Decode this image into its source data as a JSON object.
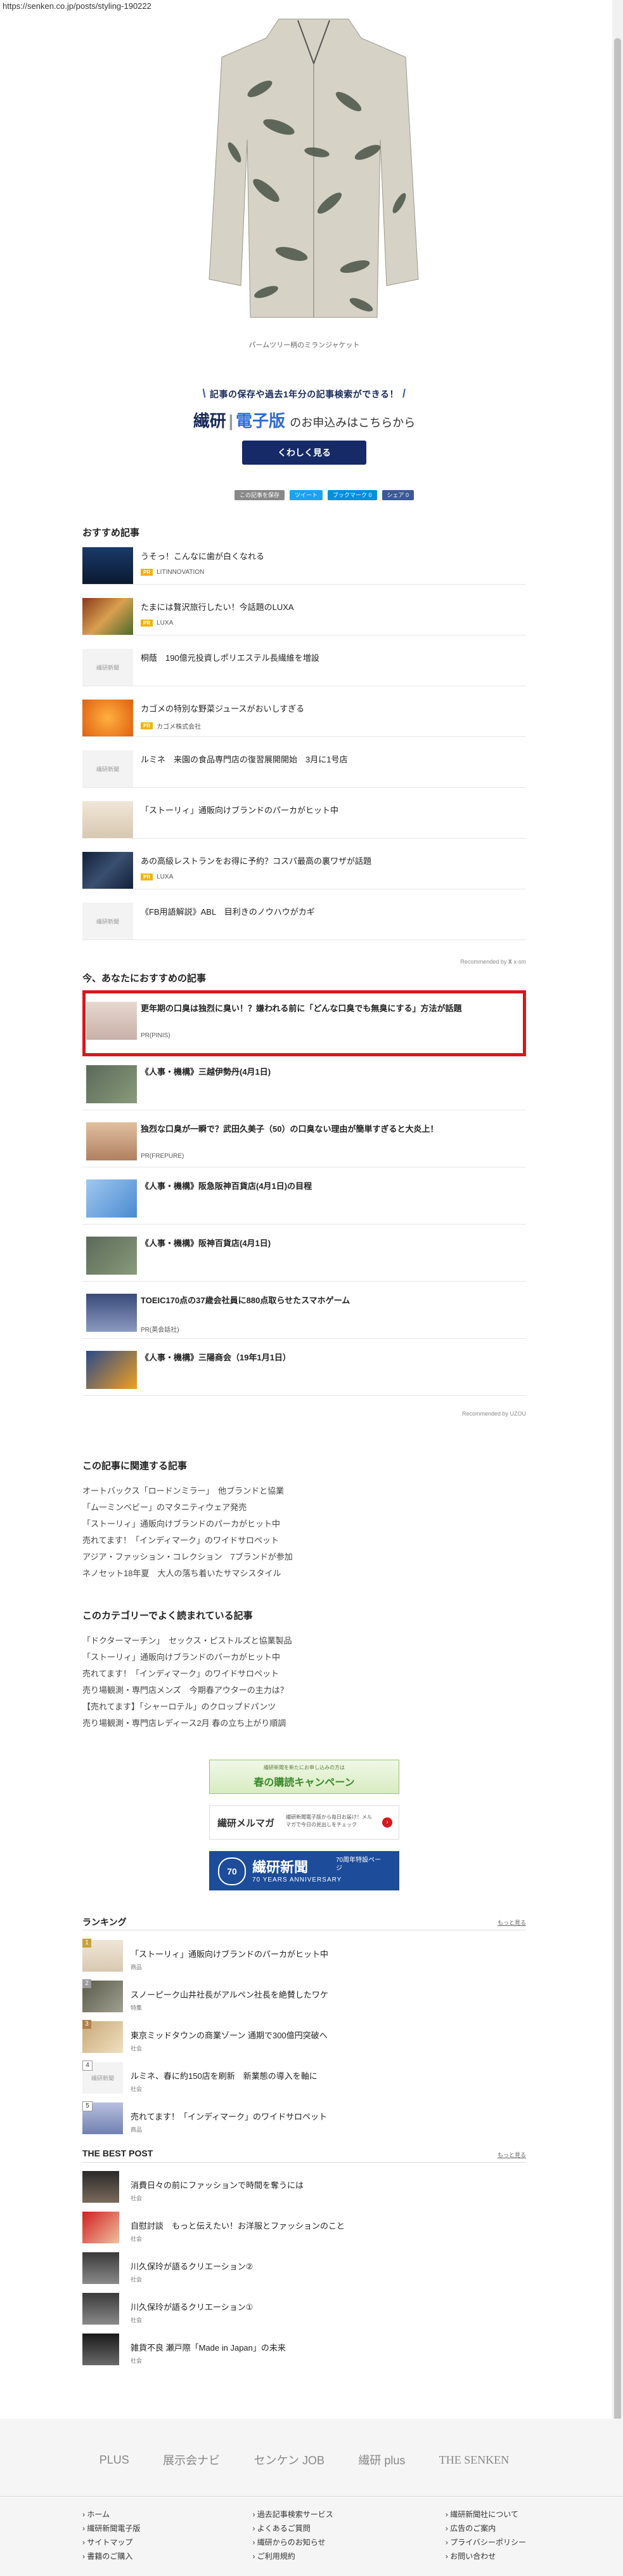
{
  "url": "https://senken.co.jp/posts/styling-190222",
  "hero": {
    "caption": "パームツリー柄のミランジャケット"
  },
  "promo": {
    "top_line": "記事の保存や過去1年分の記事検索ができる！",
    "brand": "繊研",
    "brand_blue": "電子版",
    "suffix": "のお申込みはこちらから",
    "button": "くわしく見る"
  },
  "share": [
    {
      "label": "この記事を保存",
      "color": "#888888"
    },
    {
      "label": "ツイート",
      "color": "#1da1f2"
    },
    {
      "label": "ブックマーク 0",
      "color": "#008fde"
    },
    {
      "label": "シェア 0",
      "color": "#3b5998"
    }
  ],
  "recommended": {
    "title": "おすすめ記事",
    "items": [
      {
        "title": "うそっ！こんなに歯が白くなれる",
        "sponsor": "LITINNOVATION",
        "pr": "PR"
      },
      {
        "title": "たまには贅沢旅行したい！今話題のLUXA",
        "sponsor": "LUXA",
        "pr": "PR"
      },
      {
        "title": "桐蔭　190億元投資しポリエステル長繊維を増設",
        "sponsor": "",
        "pr": "",
        "placeholder": "繊研新聞"
      },
      {
        "title": "カゴメの特別な野菜ジュースがおいしすぎる",
        "sponsor": "カゴメ株式会社",
        "pr": "PR"
      },
      {
        "title": "ルミネ　来園の食品専門店の復習展開開始　3月に1号店",
        "sponsor": "",
        "pr": "",
        "placeholder": "繊研新聞"
      },
      {
        "title": "「ストーリィ」通販向けブランドのパーカがヒット中",
        "sponsor": "",
        "pr": ""
      },
      {
        "title": "あの高級レストランをお得に予約？コスパ最高の裏ワザが話題",
        "sponsor": "LUXA",
        "pr": "PR"
      },
      {
        "title": "《FB用語解説》ABL　目利きのノウハウがカギ",
        "sponsor": "",
        "pr": "",
        "placeholder": "繊研新聞"
      }
    ],
    "note": "Recommended by 𝐗 x-sm"
  },
  "you_may_like": {
    "title": "今、あなたにおすすめの記事",
    "items": [
      {
        "title": "更年期の口臭は独烈に臭い！？嫌われる前に「どんな口臭でも無臭にする」方法が話題",
        "sponsor": "PR(PINIS)"
      },
      {
        "title": "《人事・機構》三越伊勢丹(4月1日)",
        "sponsor": ""
      },
      {
        "title": "独烈な口臭が一瞬で？武田久美子（50）の口臭ない理由が簡単すぎると大炎上！",
        "sponsor": "PR(FREPURE)"
      },
      {
        "title": "《人事・機構》阪急阪神百貨店(4月1日)の目程",
        "sponsor": ""
      },
      {
        "title": "《人事・機構》阪神百貨店(4月1日)",
        "sponsor": ""
      },
      {
        "title": "TOEIC170点の37歳会社員に880点取らせたスマホゲーム",
        "sponsor": "PR(英会話社)"
      },
      {
        "title": "《人事・機構》三陽商会（19年1月1日）",
        "sponsor": ""
      }
    ],
    "note": "Recommended by UZOU"
  },
  "related": {
    "title": "この記事に関連する記事",
    "items": [
      "オートバックス「ロードンミラー」　他ブランドと協業",
      "「ムーミンベビー」のマタニティウェア発売",
      "「ストーリィ」通販向けブランドのパーカがヒット中",
      "売れてます！「インディマーク」のワイドサロペット",
      "アジア・ファッション・コレクション　7ブランドが参加",
      "ネノセット18年夏　大人の落ち着いたサマシスタイル"
    ]
  },
  "category": {
    "title": "このカテゴリーでよく読まれている記事",
    "items": [
      "「ドクターマーチン」　セックス・ピストルズと協業製品",
      "「ストーリィ」通販向けブランドのパーカがヒット中",
      "売れてます！「インディマーク」のワイドサロペット",
      "売り場観測・専門店メンズ　今期春アウターの主力は？",
      "【売れてます】「シャーロテル」のクロップドパンツ",
      "売り場観測・専門店レディース2月 春の立ち上がり順調"
    ]
  },
  "banners": {
    "spring": "春の購読キャンペーン",
    "spring_top": "繊研新聞を新たにお申し込みの方は",
    "mailmag": "繊研メルマガ",
    "mailmag_desc": "繊研新聞電子版から毎日お届け！メルマガで今日の見出しをチェック",
    "anniv": "繊研新聞",
    "anniv_sub": "70 YEARS ANNIVERSARY",
    "anniv_badge": "70",
    "anniv_side": "70周年特設ページ"
  },
  "ranking": {
    "title": "ランキング",
    "more": "もっと見る",
    "items": [
      {
        "num": "1",
        "title": "「ストーリィ」通販向けブランドのパーカがヒット中",
        "cat": "商品"
      },
      {
        "num": "2",
        "title": "スノーピーク山井社長がアルペン社長を絶賛したワケ",
        "cat": "特集"
      },
      {
        "num": "3",
        "title": "東京ミッドタウンの商業ゾーン 通期で300億円突破へ",
        "cat": "社会"
      },
      {
        "num": "4",
        "title": "ルミネ、春に約150店を刷新　新業態の導入を軸に",
        "cat": "社会",
        "placeholder": "繊研新聞"
      },
      {
        "num": "5",
        "title": "売れてます！「インディマーク」のワイドサロペット",
        "cat": "商品"
      }
    ]
  },
  "best_post": {
    "title": "THE BEST POST",
    "more": "もっと見る",
    "items": [
      {
        "title": "消費日々の前にファッションで時間を奪うには",
        "cat": "社会"
      },
      {
        "title": "自慰討談　もっと伝えたい！お洋服とファッションのこと",
        "cat": "社会"
      },
      {
        "title": "川久保玲が語るクリエーション②",
        "cat": "社会"
      },
      {
        "title": "川久保玲が語るクリエーション①",
        "cat": "社会"
      },
      {
        "title": "雑貨不良 瀬戸際「Made in Japan」の未来",
        "cat": "社会"
      }
    ]
  },
  "footer": {
    "logos": [
      "PLUS",
      "展示会ナビ",
      "センケン JOB",
      "繊研 plus",
      "THE SENKEN"
    ],
    "col1": [
      "ホーム",
      "繊研新聞電子版",
      "サイトマップ",
      "書籍のご購入"
    ],
    "col2": [
      "過去記事検索サービス",
      "よくあるご質問",
      "繊研からのお知らせ",
      "ご利用規約"
    ],
    "col3": [
      "繊研新聞社について",
      "広告のご案内",
      "プライバシーポリシー",
      "お問い合わせ"
    ]
  },
  "colors": {
    "navy": "#152a67",
    "highlight": "#d8171e",
    "pr": "#f0b400"
  }
}
